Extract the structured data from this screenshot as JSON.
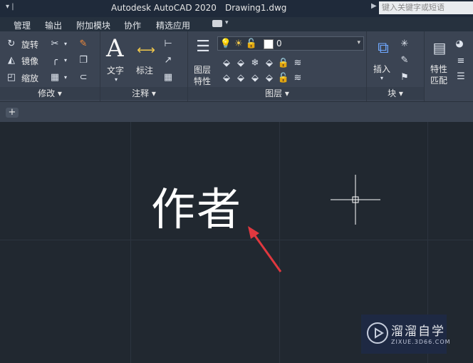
{
  "titlebar": {
    "app_title": "Autodesk AutoCAD 2020",
    "document": "Drawing1.dwg",
    "search_placeholder": "键入关键字或短语"
  },
  "tabs": [
    "管理",
    "输出",
    "附加模块",
    "协作",
    "精选应用"
  ],
  "ribbon": {
    "modify": {
      "title": "修改",
      "items": [
        "旋转",
        "镜像",
        "缩放"
      ]
    },
    "annotation": {
      "title": "注释",
      "text_label": "文字",
      "dim_label": "标注"
    },
    "layers": {
      "title": "图层",
      "props_label_1": "图层",
      "props_label_2": "特性",
      "current_layer": "0"
    },
    "block": {
      "title": "块",
      "insert_label": "插入"
    },
    "properties": {
      "label_1": "特性",
      "label_2": "匹配"
    }
  },
  "doc_tabs": {
    "new_tab": "+"
  },
  "canvas": {
    "text_object": "作者"
  },
  "watermark": {
    "brand": "溜溜自学",
    "url": "ZIXUE.3D66.COM"
  },
  "colors": {
    "background": "#212830",
    "ribbon": "#3b4453",
    "arrow": "#e0383f"
  }
}
